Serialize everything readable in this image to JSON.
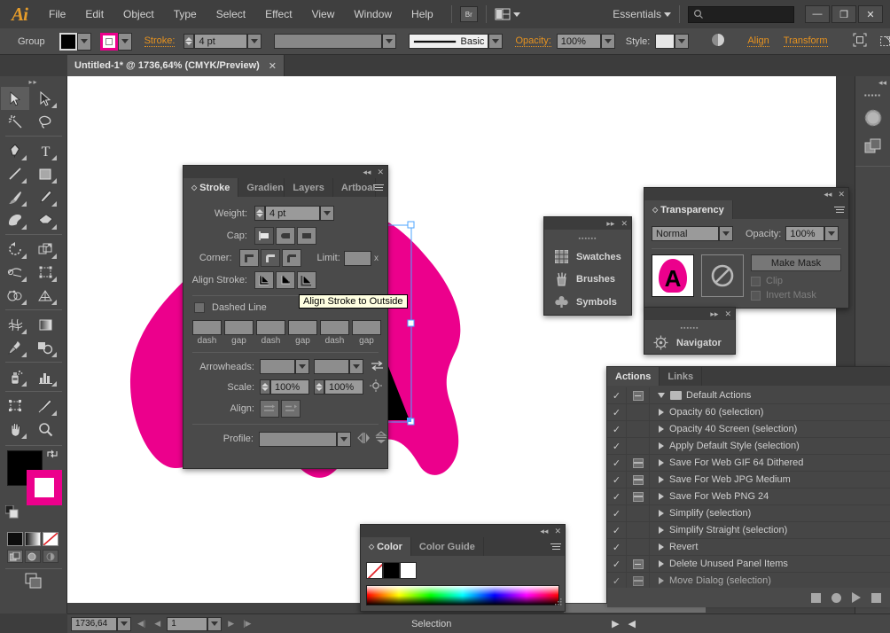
{
  "app": {
    "logo": "Ai",
    "name": "Adobe Illustrator"
  },
  "menubar": {
    "items": [
      "File",
      "Edit",
      "Object",
      "Type",
      "Select",
      "Effect",
      "View",
      "Window",
      "Help"
    ],
    "bridge_label": "Br",
    "arrange_label": "arrange-documents",
    "workspace": "Essentials",
    "search_placeholder": "",
    "search_value": "",
    "window_buttons": {
      "minimize": "—",
      "maximize": "❐",
      "close": "✕"
    }
  },
  "controlbar": {
    "object_type": "Group",
    "fill_color": "#000000",
    "stroke_color": "#ec008c",
    "stroke_label": "Stroke:",
    "stroke_weight": "4 pt",
    "brush_value": "",
    "profile_value": "Basic",
    "opacity_label": "Opacity:",
    "opacity_value": "100%",
    "style_label": "Style:",
    "style_value": "",
    "align_label": "Align",
    "transform_label": "Transform"
  },
  "document": {
    "tab_title": "Untitled-1* @ 1736,64% (CMYK/Preview)",
    "close_glyph": "✕"
  },
  "tools": {
    "items": [
      {
        "name": "selection-tool",
        "glyph": "selection",
        "selected": true
      },
      {
        "name": "direct-selection-tool",
        "glyph": "direct-selection",
        "selected": false
      },
      {
        "name": "magic-wand-tool",
        "glyph": "magic-wand",
        "selected": false
      },
      {
        "name": "lasso-tool",
        "glyph": "lasso",
        "selected": false
      },
      {
        "name": "pen-tool",
        "glyph": "pen",
        "selected": false
      },
      {
        "name": "type-tool",
        "glyph": "type",
        "selected": false
      },
      {
        "name": "line-segment-tool",
        "glyph": "line",
        "selected": false
      },
      {
        "name": "rectangle-tool",
        "glyph": "rectangle",
        "selected": false
      },
      {
        "name": "paintbrush-tool",
        "glyph": "paintbrush",
        "selected": false
      },
      {
        "name": "pencil-tool",
        "glyph": "pencil",
        "selected": false
      },
      {
        "name": "blob-brush-tool",
        "glyph": "blob-brush",
        "selected": false
      },
      {
        "name": "eraser-tool",
        "glyph": "eraser",
        "selected": false
      },
      {
        "name": "rotate-tool",
        "glyph": "rotate",
        "selected": false
      },
      {
        "name": "scale-tool",
        "glyph": "scale",
        "selected": false
      },
      {
        "name": "width-tool",
        "glyph": "width",
        "selected": false
      },
      {
        "name": "free-transform-tool",
        "glyph": "free-transform",
        "selected": false
      },
      {
        "name": "shape-builder-tool",
        "glyph": "shape-builder",
        "selected": false
      },
      {
        "name": "perspective-grid-tool",
        "glyph": "perspective-grid",
        "selected": false
      },
      {
        "name": "mesh-tool",
        "glyph": "mesh",
        "selected": false
      },
      {
        "name": "gradient-tool",
        "glyph": "gradient",
        "selected": false
      },
      {
        "name": "eyedropper-tool",
        "glyph": "eyedropper",
        "selected": false
      },
      {
        "name": "blend-tool",
        "glyph": "blend",
        "selected": false
      },
      {
        "name": "symbol-sprayer-tool",
        "glyph": "symbol-sprayer",
        "selected": false
      },
      {
        "name": "column-graph-tool",
        "glyph": "column-graph",
        "selected": false
      },
      {
        "name": "artboard-tool",
        "glyph": "artboard",
        "selected": false
      },
      {
        "name": "slice-tool",
        "glyph": "slice",
        "selected": false
      },
      {
        "name": "hand-tool",
        "glyph": "hand",
        "selected": false
      },
      {
        "name": "zoom-tool",
        "glyph": "zoom",
        "selected": false
      }
    ],
    "fill_color": "#000000",
    "stroke_color": "#ec008c",
    "swap_icon": "swap-fill-stroke-icon",
    "default_icon": "default-fill-stroke-icon",
    "modes": [
      "color-mode",
      "gradient-mode",
      "none-mode"
    ],
    "draw_modes": [
      "draw-normal",
      "draw-behind",
      "draw-inside"
    ],
    "screen_mode": "change-screen-mode"
  },
  "stroke_panel": {
    "tabs": [
      {
        "label": "Stroke",
        "active": true
      },
      {
        "label": "Gradient",
        "active": false
      },
      {
        "label": "Layers",
        "active": false
      },
      {
        "label": "Artboards",
        "active": false
      }
    ],
    "weight_label": "Weight:",
    "weight_value": "4 pt",
    "cap_label": "Cap:",
    "cap_options": [
      "butt-cap",
      "round-cap",
      "projecting-cap"
    ],
    "cap_selected": 0,
    "corner_label": "Corner:",
    "corner_options": [
      "miter-join",
      "round-join",
      "bevel-join"
    ],
    "corner_selected": 1,
    "limit_label": "Limit:",
    "limit_value": "",
    "limit_unit": "x",
    "align_label": "Align Stroke:",
    "align_options": [
      "align-stroke-center",
      "align-stroke-inside",
      "align-stroke-outside"
    ],
    "dashed_label": "Dashed Line",
    "dashed_checked": false,
    "dash_fields": [
      {
        "value": "",
        "caption": "dash"
      },
      {
        "value": "",
        "caption": "gap"
      },
      {
        "value": "",
        "caption": "dash"
      },
      {
        "value": "",
        "caption": "gap"
      },
      {
        "value": "",
        "caption": "dash"
      },
      {
        "value": "",
        "caption": "gap"
      }
    ],
    "arrowheads_label": "Arrowheads:",
    "arrow_start": "",
    "arrow_end": "",
    "swap_arrows_icon": "swap-arrowheads-icon",
    "scale_label": "Scale:",
    "scale_start": "100%",
    "scale_end": "100%",
    "link_scales_icon": "link-arrowhead-scales-icon",
    "align_dash_label": "Align:",
    "align_dash_options": [
      "dashes-preserve",
      "dashes-adjust"
    ],
    "profile_label": "Profile:",
    "profile_value": "",
    "flip_across_icon": "flip-across-icon",
    "flip_along_icon": "flip-along-icon"
  },
  "tooltip": {
    "text": "Align Stroke to Outside"
  },
  "swatches_panel": {
    "items": [
      {
        "label": "Swatches",
        "icon": "swatches-icon"
      },
      {
        "label": "Brushes",
        "icon": "brushes-icon"
      },
      {
        "label": "Symbols",
        "icon": "symbols-icon"
      }
    ]
  },
  "transparency_panel": {
    "title": "Transparency",
    "blend_mode": "Normal",
    "opacity_label": "Opacity:",
    "opacity_value": "100%",
    "make_mask_label": "Make Mask",
    "clip_label": "Clip",
    "clip_checked": false,
    "invert_label": "Invert Mask",
    "invert_checked": false,
    "thumb_letter": "A",
    "mask_icon": "no-mask-icon"
  },
  "navigator_panel": {
    "label": "Navigator",
    "icon": "navigator-icon"
  },
  "actions_panel": {
    "tabs": [
      {
        "label": "Actions",
        "active": true
      },
      {
        "label": "Links",
        "active": false
      }
    ],
    "rows": [
      {
        "check": true,
        "box": "dash",
        "expand": "down",
        "folder": true,
        "label": "Default Actions",
        "indent": 0
      },
      {
        "check": true,
        "box": "none",
        "expand": "right",
        "folder": false,
        "label": "Opacity 60 (selection)",
        "indent": 1
      },
      {
        "check": true,
        "box": "none",
        "expand": "right",
        "folder": false,
        "label": "Opacity 40 Screen (selection)",
        "indent": 1
      },
      {
        "check": true,
        "box": "none",
        "expand": "right",
        "folder": false,
        "label": "Apply Default Style (selection)",
        "indent": 1
      },
      {
        "check": true,
        "box": "lined",
        "expand": "right",
        "folder": false,
        "label": "Save For Web GIF 64 Dithered",
        "indent": 1
      },
      {
        "check": true,
        "box": "lined",
        "expand": "right",
        "folder": false,
        "label": "Save For Web JPG Medium",
        "indent": 1
      },
      {
        "check": true,
        "box": "lined",
        "expand": "right",
        "folder": false,
        "label": "Save For Web PNG 24",
        "indent": 1
      },
      {
        "check": true,
        "box": "none",
        "expand": "right",
        "folder": false,
        "label": "Simplify (selection)",
        "indent": 1
      },
      {
        "check": true,
        "box": "none",
        "expand": "right",
        "folder": false,
        "label": "Simplify Straight (selection)",
        "indent": 1
      },
      {
        "check": true,
        "box": "none",
        "expand": "right",
        "folder": false,
        "label": "Revert",
        "indent": 1
      },
      {
        "check": true,
        "box": "dash",
        "expand": "right",
        "folder": false,
        "label": "Delete Unused Panel Items",
        "indent": 1
      },
      {
        "check": true,
        "box": "lined",
        "expand": "right",
        "folder": false,
        "label": "Move Dialog (selection)",
        "indent": 1
      }
    ],
    "footer_icons": [
      "stop-icon",
      "record-icon",
      "play-icon",
      "new-set-icon",
      "new-action-icon",
      "delete-icon"
    ]
  },
  "color_panel": {
    "tabs": [
      {
        "label": "Color",
        "active": true
      },
      {
        "label": "Color Guide",
        "active": false
      }
    ],
    "none_swatch": "none",
    "fill_swatch": "#000000",
    "stroke_swatch": "#ffffff",
    "spectrum": "color-spectrum-ramp"
  },
  "statusbar": {
    "zoom_value": "1736,64",
    "artboard_value": "1",
    "status_text": "Selection",
    "first_icon": "first-artboard-icon",
    "prev_icon": "previous-artboard-icon",
    "next_icon": "next-artboard-icon",
    "last_icon": "last-artboard-icon"
  },
  "artwork": {
    "blob_color": "#ec008c",
    "letter": "A",
    "letter_color": "#000000",
    "selection_color": "#4da6ff"
  }
}
